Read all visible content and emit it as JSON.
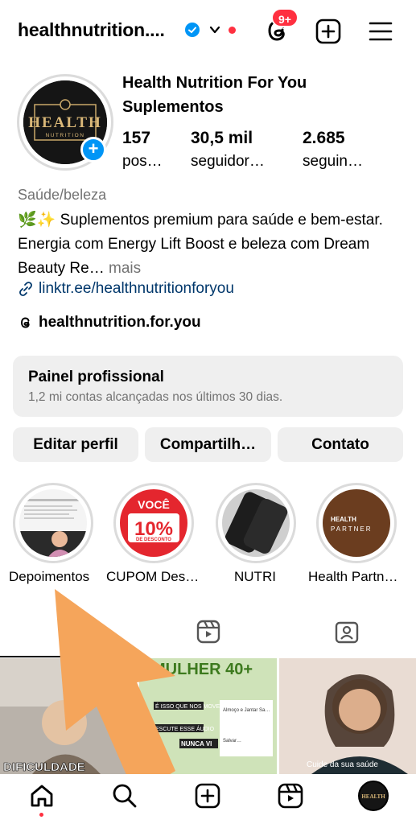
{
  "header": {
    "username": "healthnutrition....",
    "notification_badge": "9+"
  },
  "profile": {
    "display_name": "Health Nutrition For You Suplementos",
    "avatar_text": "HEALTH",
    "avatar_sub": "NUTRITION",
    "stats": [
      {
        "number": "157",
        "label": "pos…"
      },
      {
        "number": "30,5 mil",
        "label": "seguidor…"
      },
      {
        "number": "2.685",
        "label": "seguin…"
      }
    ],
    "category": "Saúde/beleza",
    "bio": "🌿✨ Suplementos premium para saúde e bem-estar. Energia com Energy Lift Boost e beleza com Dream Beauty Re…",
    "bio_more": " mais",
    "link": "linktr.ee/healthnutritionforyou",
    "threads_handle": "healthnutrition.for.you"
  },
  "professional_panel": {
    "title": "Painel profissional",
    "subtitle": "1,2 mi contas alcançadas nos últimos 30 dias."
  },
  "actions": {
    "edit": "Editar perfil",
    "share": "Compartilh…",
    "contact": "Contato"
  },
  "highlights": [
    {
      "label": "Depoimentos"
    },
    {
      "label": "CUPOM Des…",
      "img_title": "VOCÊ",
      "img_big": "10%",
      "img_sub": "DE DESCONTO"
    },
    {
      "label": "NUTRI"
    },
    {
      "label": "Health Partn…",
      "img_line1": "HEALTH",
      "img_line2": "PARTNER"
    }
  ],
  "grid_posts": [
    {
      "caption": "DIFICULDADE"
    },
    {
      "caption": "MULHER 40+",
      "line1": "É ISSO QUE NOS MOVE",
      "line2": "ESCUTE ESSE ÁUDIO",
      "line3": "NUNCA VI",
      "line4": "Almoço e Jantar Sa…",
      "line5": "Salvar…"
    },
    {
      "caption": "Cuide da sua saúde"
    }
  ],
  "colors": {
    "accent_blue": "#0095f6",
    "link_blue": "#00376b",
    "notification_red": "#ff3040",
    "annotation_arrow": "#f5a55b"
  }
}
